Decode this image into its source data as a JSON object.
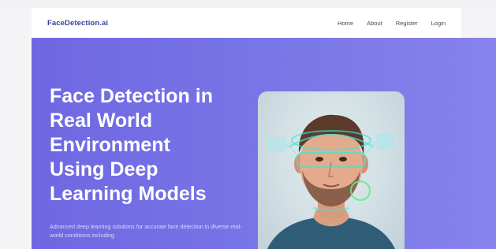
{
  "nav": {
    "brand": "FaceDetection.ai",
    "links": [
      "Home",
      "About",
      "Register",
      "Login"
    ]
  },
  "hero": {
    "title": "Face Detection in\nReal World\nEnvironment\nUsing Deep\nLearning Models",
    "description": "Advanced deep learning solutions for accurate face detection in diverse real-world conditions including"
  },
  "colors": {
    "brand": "#3a3f9a",
    "hero_gradient_start": "#6f67e2",
    "hero_gradient_end": "#8683ec",
    "scan_accent": "#3fe6d8"
  }
}
